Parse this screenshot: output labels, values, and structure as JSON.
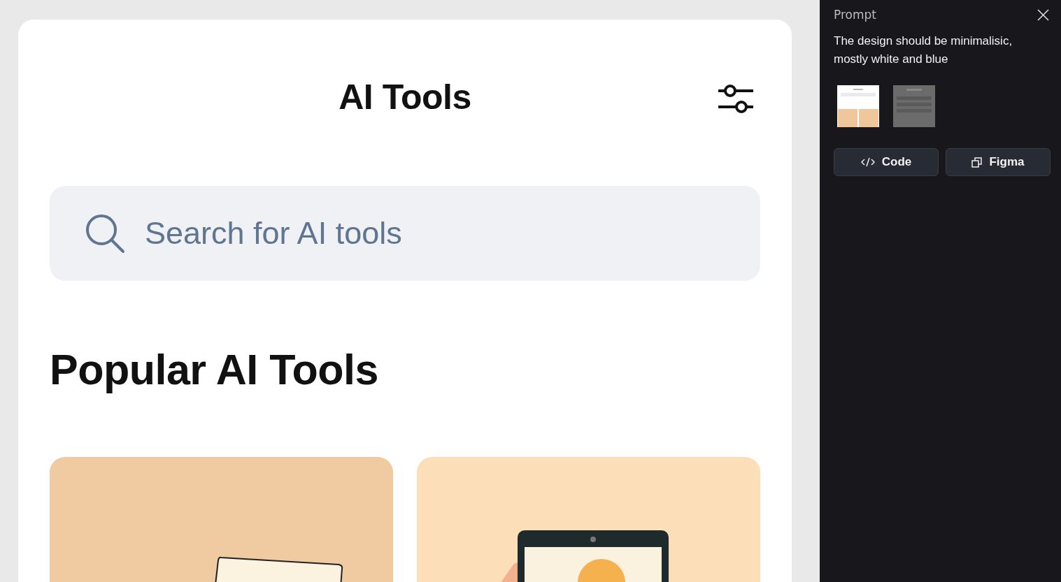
{
  "app": {
    "title": "AI Tools",
    "search": {
      "placeholder": "Search for AI tools"
    },
    "section_title": "Popular AI Tools",
    "cards": [
      {
        "kind": "notebook"
      },
      {
        "kind": "tablet"
      }
    ]
  },
  "panel": {
    "label": "Prompt",
    "text": "The design should be minimalisic, mostly white and blue",
    "buttons": [
      {
        "label": "Code",
        "kind": "code"
      },
      {
        "label": "Figma",
        "kind": "figma"
      }
    ]
  }
}
